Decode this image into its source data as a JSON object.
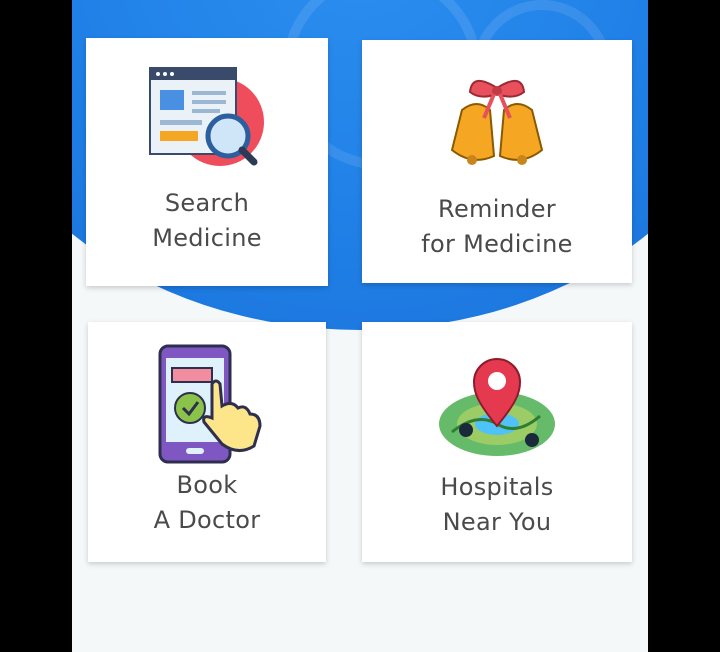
{
  "app": {
    "cards": [
      {
        "id": "search",
        "line1": "Search",
        "line2": "Medicine",
        "icon": "search-document-icon"
      },
      {
        "id": "reminder",
        "line1": "Reminder",
        "line2": "for Medicine",
        "icon": "bells-icon"
      },
      {
        "id": "book",
        "line1": "Book",
        "line2": "A Doctor",
        "icon": "phone-tap-icon"
      },
      {
        "id": "hospitals",
        "line1": "Hospitals",
        "line2": "Near You",
        "icon": "map-pin-icon"
      }
    ]
  },
  "colors": {
    "header_blue": "#1f7fe6",
    "background": "#f4f8f8",
    "card": "#ffffff",
    "label_text": "#4a4a4a"
  }
}
